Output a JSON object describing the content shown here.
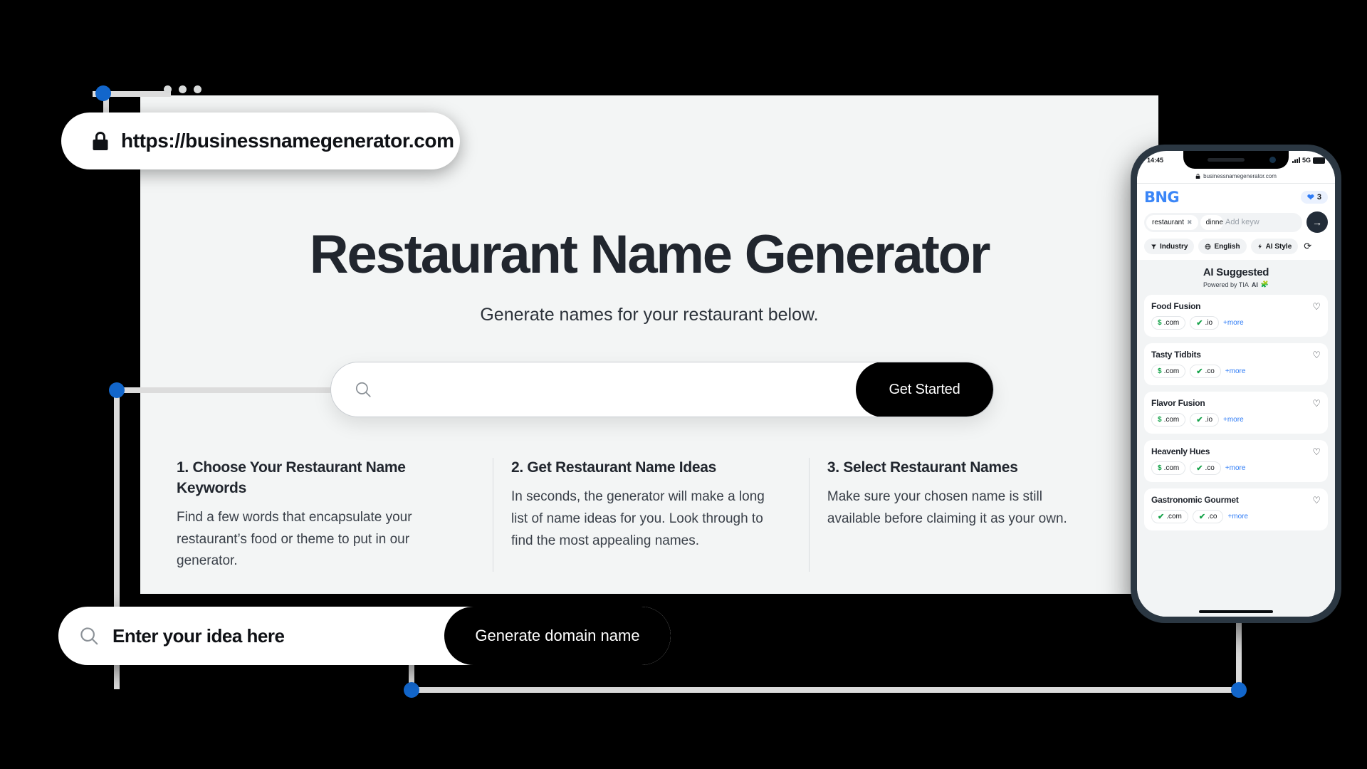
{
  "colors": {
    "accent_blue": "#1266CB",
    "logo_blue": "#3b86f7",
    "available_green": "#16a34a",
    "dark": "#21262e"
  },
  "browser": {
    "url": "https://businessnamegenerator.com",
    "lock_icon": "lock-icon",
    "window_dots": "window-controls-dots"
  },
  "hero": {
    "title": "Restaurant Name Generator",
    "subtitle": "Generate names for your restaurant below.",
    "search": {
      "placeholder": "",
      "value": "",
      "icon": "search-icon",
      "cta": "Get Started"
    }
  },
  "steps": [
    {
      "title": "1. Choose Your Restaurant Name Keywords",
      "body": "Find a few words that encapsulate your restaurant’s food or theme to put in our generator."
    },
    {
      "title": "2. Get Restaurant Name Ideas",
      "body": "In seconds, the generator will make a long list of name ideas for you. Look through to find the most appealing names."
    },
    {
      "title": "3. Select Restaurant Names",
      "body": "Make sure your chosen name is still available before claiming it as your own."
    }
  ],
  "bottom_search": {
    "icon": "search-icon",
    "value": "Enter your idea here",
    "placeholder": "Enter your idea here",
    "cta": "Generate domain name"
  },
  "phone": {
    "status": {
      "time": "14:45",
      "network": "5G",
      "signal_icon": "signal-bars-icon",
      "battery_icon": "battery-icon"
    },
    "address": {
      "lock_icon": "lock-icon",
      "domain": "businessnamegenerator.com"
    },
    "logo": "BNG",
    "favorites": {
      "icon": "heart-filled-icon",
      "count": "3"
    },
    "keywords": {
      "chips": [
        {
          "label": "restaurant",
          "remove_icon": "close-icon"
        },
        {
          "label": "dinne",
          "remove_icon": "close-icon"
        }
      ],
      "placeholder": "Add keyw",
      "submit_icon": "arrow-right-icon"
    },
    "filters": [
      {
        "label": "Industry",
        "icon": "filter-icon"
      },
      {
        "label": "English",
        "icon": "globe-icon"
      },
      {
        "label": "AI Style",
        "icon": "bolt-icon"
      }
    ],
    "refresh_icon": "refresh-icon",
    "results_title": "AI Suggested",
    "results_subtitle_prefix": "Powered by TIA",
    "results_subtitle_bold": "AI",
    "results_subtitle_icon": "chip-icon",
    "names": [
      {
        "name": "Food Fusion",
        "favorite_icon": "heart-outline-icon",
        "domains": [
          {
            "tld": ".com",
            "status": "premium",
            "marker": "$"
          },
          {
            "tld": ".io",
            "status": "available",
            "marker": "✔"
          }
        ],
        "more": "+more"
      },
      {
        "name": "Tasty Tidbits",
        "favorite_icon": "heart-outline-icon",
        "domains": [
          {
            "tld": ".com",
            "status": "premium",
            "marker": "$"
          },
          {
            "tld": ".co",
            "status": "available",
            "marker": "✔"
          }
        ],
        "more": "+more"
      },
      {
        "name": "Flavor Fusion",
        "favorite_icon": "heart-outline-icon",
        "domains": [
          {
            "tld": ".com",
            "status": "premium",
            "marker": "$"
          },
          {
            "tld": ".io",
            "status": "available",
            "marker": "✔"
          }
        ],
        "more": "+more"
      },
      {
        "name": "Heavenly Hues",
        "favorite_icon": "heart-outline-icon",
        "domains": [
          {
            "tld": ".com",
            "status": "premium",
            "marker": "$"
          },
          {
            "tld": ".co",
            "status": "available",
            "marker": "✔"
          }
        ],
        "more": "+more"
      },
      {
        "name": "Gastronomic Gourmet",
        "favorite_icon": "heart-outline-icon",
        "domains": [
          {
            "tld": ".com",
            "status": "available",
            "marker": "✔"
          },
          {
            "tld": ".co",
            "status": "available",
            "marker": "✔"
          }
        ],
        "more": "+more"
      }
    ]
  }
}
